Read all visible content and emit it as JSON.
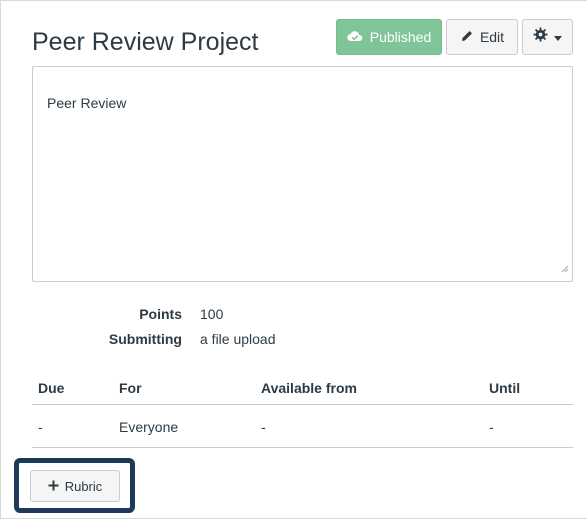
{
  "header": {
    "title": "Peer Review Project",
    "published_label": "Published",
    "edit_label": "Edit"
  },
  "description": {
    "text": "Peer Review"
  },
  "details": [
    {
      "label": "Points",
      "value": "100"
    },
    {
      "label": "Submitting",
      "value": "a file upload"
    }
  ],
  "dates_table": {
    "headers": [
      "Due",
      "For",
      "Available from",
      "Until"
    ],
    "rows": [
      [
        "-",
        "Everyone",
        "-",
        "-"
      ]
    ]
  },
  "rubric_button": {
    "label": "Rubric"
  },
  "colors": {
    "published_bg": "#7fc597",
    "highlight_border": "#1e3a5a",
    "text": "#2d3b45"
  },
  "icons": {
    "published": "check-cloud-icon",
    "edit": "pencil-icon",
    "settings": "gear-icon",
    "dropdown": "caret-down-icon",
    "add": "plus-icon"
  }
}
